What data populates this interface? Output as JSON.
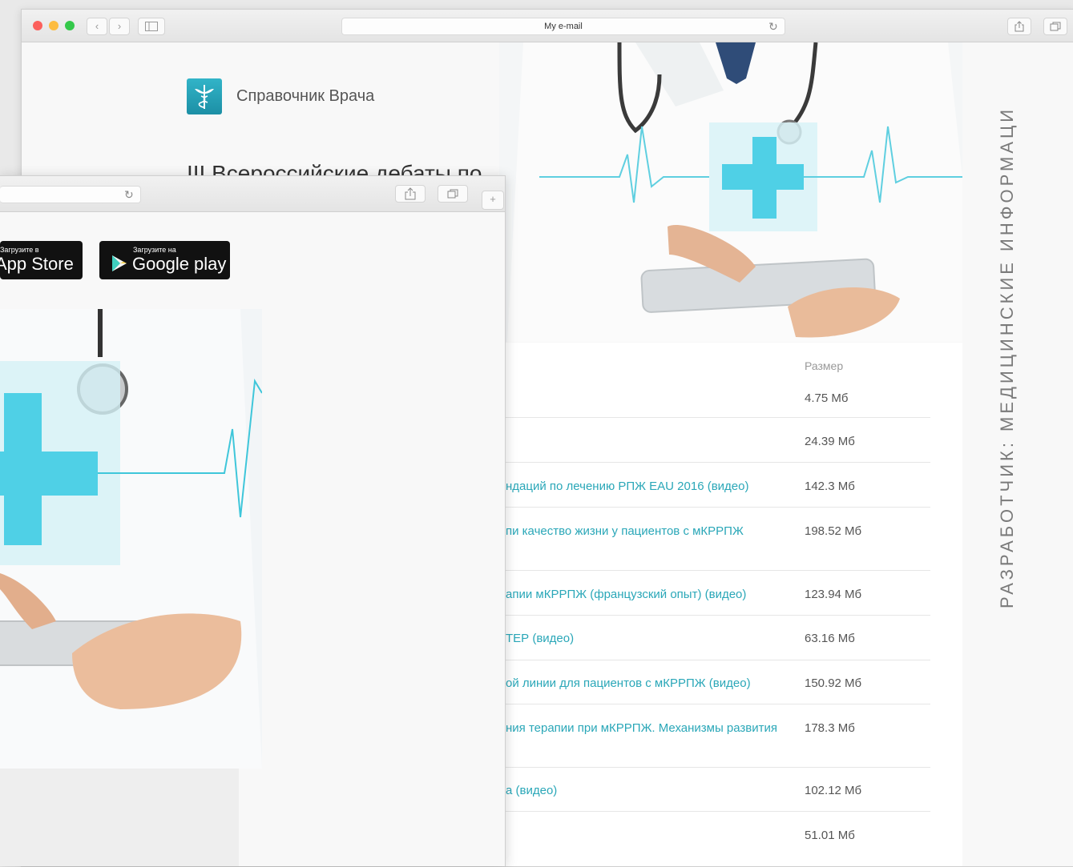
{
  "back_window": {
    "address": "My e-mail",
    "brand_name": "Справочник Врача",
    "headline": "III Всероссийские дебаты по"
  },
  "file_table": {
    "size_header": "Размер",
    "rows": [
      {
        "name": "",
        "size": "4.75 Мб"
      },
      {
        "name": "",
        "size": "24.39 Мб"
      },
      {
        "name": "ндаций по лечению РПЖ EAU 2016 (видео)",
        "size": "142.3 Мб"
      },
      {
        "name": "пи качество жизни у пациентов с мКРРПЖ",
        "size": "198.52 Мб"
      },
      {
        "name": "апии мКРРПЖ (французский опыт) (видео)",
        "size": "123.94 Мб"
      },
      {
        "name": "ТЕР (видео)",
        "size": "63.16 Мб"
      },
      {
        "name": "ой линии для пациентов с мКРРПЖ (видео)",
        "size": "150.92 Мб"
      },
      {
        "name": "ния терапии при мКРРПЖ. Механизмы развития",
        "size": "178.3 Мб"
      },
      {
        "name": "а (видео)",
        "size": "102.12 Мб"
      },
      {
        "name": "",
        "size": "51.01 Мб"
      }
    ]
  },
  "front_window": {
    "appstore_small": "Загрузите в",
    "appstore_big": "App Store",
    "googleplay_small": "Загрузите на",
    "googleplay_big": "Google play"
  },
  "developer_text": "РАЗРАБОТЧИК: МЕДИЦИНСКИЕ ИНФОРМАЦИ",
  "colors": {
    "accent": "#2aa7b8",
    "cross": "#4fd0e6",
    "traffic_red": "#fc605c",
    "traffic_yellow": "#fdbc40",
    "traffic_green": "#34c84a"
  }
}
